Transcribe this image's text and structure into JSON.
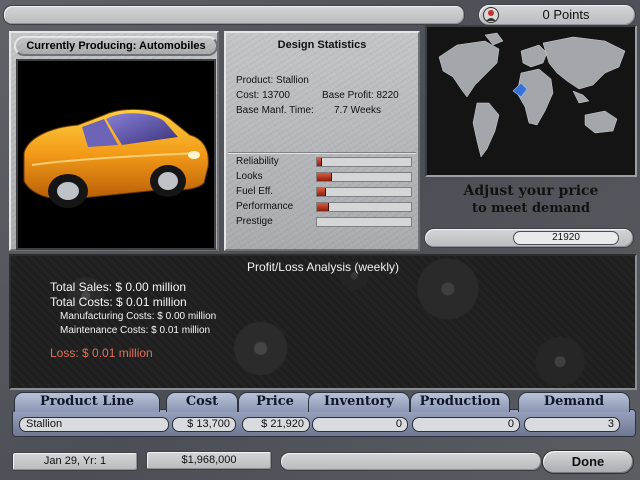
{
  "header": {
    "points": "0 Points"
  },
  "producing": {
    "title": "Currently Producing: Automobiles"
  },
  "design": {
    "title": "Design Statistics",
    "product": "Product: Stallion",
    "cost": "Cost: 13700",
    "base_profit": "Base Profit: 8220",
    "base_manf_label": "Base Manf. Time:",
    "base_manf_value": "7.7 Weeks",
    "stats": [
      {
        "label": "Reliability",
        "level": 0.05
      },
      {
        "label": "Looks",
        "level": 0.16
      },
      {
        "label": "Fuel Eff.",
        "level": 0.1
      },
      {
        "label": "Performance",
        "level": 0.13
      },
      {
        "label": "Prestige",
        "level": 0
      }
    ]
  },
  "price": {
    "caption_line1": "Adjust your price",
    "caption_line2": "to meet demand",
    "value": "21920"
  },
  "analysis": {
    "title": "Profit/Loss Analysis (weekly)",
    "total_sales": "Total Sales: $  0.00 million",
    "total_costs": "Total Costs: $  0.01 million",
    "manufacturing": "Manufacturing Costs: $  0.00 million",
    "maintenance": "Maintenance Costs: $  0.01 million",
    "loss": "Loss: $  0.01 million"
  },
  "table": {
    "headers": [
      "Product Line",
      "Cost",
      "Price",
      "Inventory",
      "Production",
      "Demand"
    ],
    "row": {
      "product": "Stallion",
      "cost": "$ 13,700",
      "price": "$ 21,920",
      "inventory": "0",
      "production": "0",
      "demand": "3"
    }
  },
  "footer": {
    "date": "Jan 29, Yr: 1",
    "money": "$1,968,000",
    "done_label": "Done"
  },
  "colors": {
    "frame": "#55595e",
    "panel": "#b4b6b9",
    "header_tab": "#9aa4c0",
    "loss_text": "#e0705a",
    "car": "#f0a020"
  },
  "icons": [
    "person-icon",
    "world-map",
    "car-image"
  ]
}
